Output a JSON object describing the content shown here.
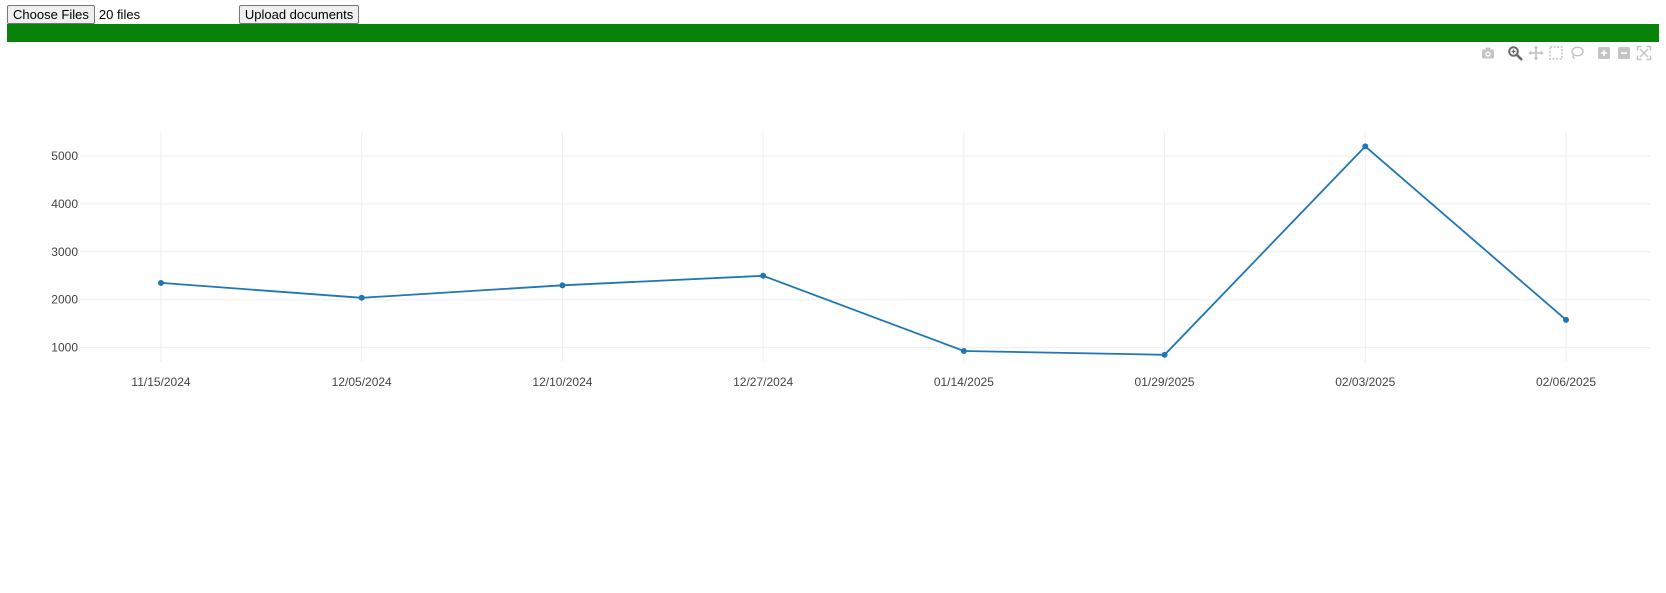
{
  "upload": {
    "choose_label": "Choose Files",
    "file_status": "20 files",
    "upload_label": "Upload documents"
  },
  "progress": {
    "percent": 100,
    "fill_color": "#088208"
  },
  "modebar": {
    "icons": [
      "camera-icon",
      "zoom-icon",
      "pan-icon",
      "box-select-icon",
      "lasso-select-icon",
      "zoom-in-icon",
      "zoom-out-icon",
      "autoscale-icon"
    ]
  },
  "chart_data": {
    "type": "line",
    "x": [
      "11/15/2024",
      "12/05/2024",
      "12/10/2024",
      "12/27/2024",
      "01/14/2025",
      "01/29/2025",
      "02/03/2025",
      "02/06/2025"
    ],
    "y": [
      2350,
      2040,
      2300,
      2500,
      930,
      850,
      5200,
      1580
    ],
    "ylim": [
      700,
      5500
    ],
    "yticks": [
      1000,
      2000,
      3000,
      4000,
      5000
    ],
    "line_color": "#1f77b4",
    "grid": true,
    "legend": "none"
  }
}
